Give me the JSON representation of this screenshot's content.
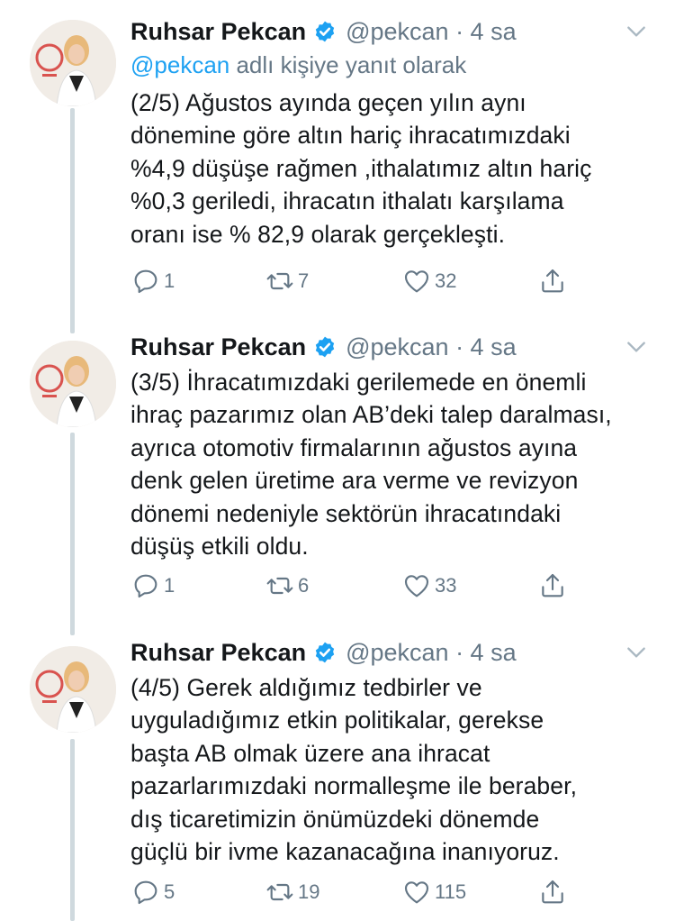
{
  "colors": {
    "link": "#1da1f2",
    "muted": "#657786",
    "text": "#14171a",
    "thread_line": "#cfd9de",
    "verified": "#1da1f2"
  },
  "tweets": [
    {
      "name": "Ruhsar Pekcan",
      "handle": "@pekcan · 4 sa",
      "reply_prefix": "@pekcan",
      "reply_suffix": " adlı kişiye yanıt olarak",
      "text": "(2/5) Ağustos ayında geçen yılın aynı\ndönemine göre altın hariç ihracatımızdaki\n%4,9 düşüşe rağmen ,ithalatımız altın hariç\n%0,3 geriledi, ihracatın ithalatı karşılama\noranı ise % 82,9 olarak gerçekleşti.",
      "replies": "1",
      "retweets": "7",
      "likes": "32"
    },
    {
      "name": "Ruhsar Pekcan",
      "handle": "@pekcan · 4 sa",
      "text": "(3/5) İhracatımızdaki gerilemede en önemli\nihraç pazarımız olan AB’deki talep daralması,\nayrıca otomotiv firmalarının ağustos ayına\ndenk gelen üretime ara verme ve revizyon\ndönemi nedeniyle sektörün ihracatındaki\ndüşüş etkili oldu.",
      "replies": "1",
      "retweets": "6",
      "likes": "33"
    },
    {
      "name": "Ruhsar Pekcan",
      "handle": "@pekcan · 4 sa",
      "text": "(4/5) Gerek aldığımız tedbirler ve\nuyguladığımız etkin politikalar,  gerekse\nbaşta AB olmak üzere ana ihracat\npazarlarımızdaki normalleşme ile beraber,\ndış ticaretimizin önümüzdeki dönemde\ngüçlü bir ivme kazanacağına inanıyoruz.",
      "replies": "5",
      "retweets": "19",
      "likes": "115"
    }
  ]
}
